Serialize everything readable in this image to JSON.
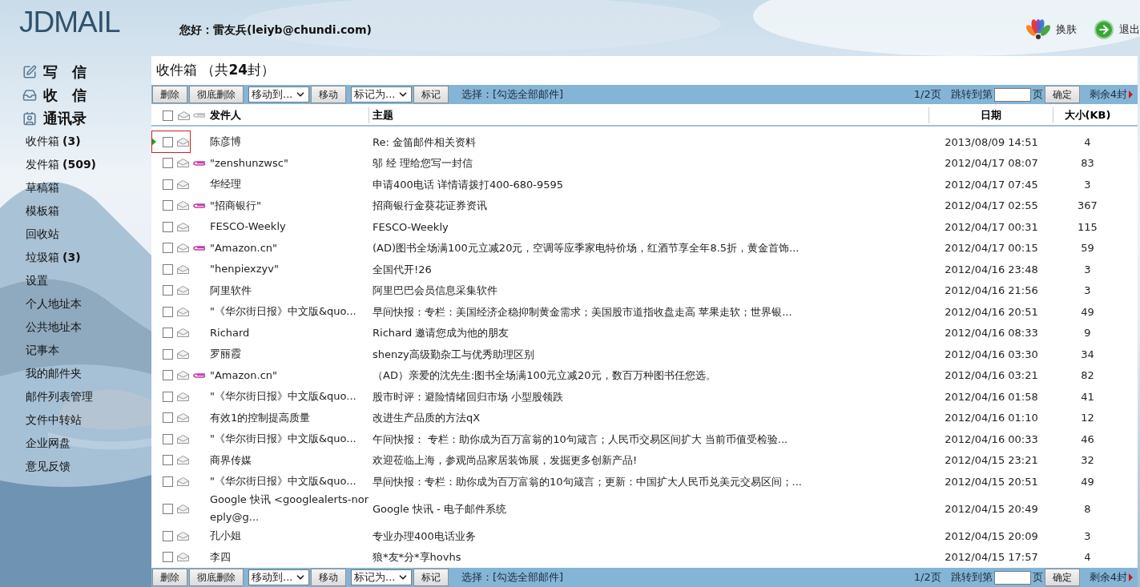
{
  "logo": "JDMAIL",
  "greeting": "您好：雷友兵(leiyb@chundi.com)",
  "header_links": [
    {
      "kind": "skin",
      "label": "换肤"
    },
    {
      "kind": "logout",
      "label": "退出"
    }
  ],
  "sidebar": {
    "actions": [
      {
        "kind": "compose",
        "label": "写　信"
      },
      {
        "kind": "receive",
        "label": "收　信"
      },
      {
        "kind": "contacts",
        "label": "通讯录"
      }
    ],
    "folders": [
      {
        "label": "收件箱",
        "count": "(3)"
      },
      {
        "label": "发件箱",
        "count": "(509)"
      },
      {
        "label": "草稿箱"
      },
      {
        "label": "模板箱"
      },
      {
        "label": "回收站"
      },
      {
        "label": "垃圾箱",
        "count": "(3)"
      },
      {
        "label": "设置"
      },
      {
        "label": "个人地址本"
      },
      {
        "label": "公共地址本"
      },
      {
        "label": "记事本"
      },
      {
        "label": "我的邮件夹"
      },
      {
        "label": "邮件列表管理"
      },
      {
        "label": "文件中转站"
      },
      {
        "label": "企业网盘"
      },
      {
        "label": "意见反馈"
      }
    ]
  },
  "title": "收件箱 （共**24**封）",
  "toolbars": [
    {
      "buttons": [
        "删除",
        "彻底删除"
      ],
      "move_select": "移动到...",
      "move_button": "移动",
      "mark_select": "标记为...",
      "mark_button": "标记",
      "select_all": "选择：[勾选全部邮件]",
      "page": "1/2页",
      "jump_label": "跳转到第",
      "page_suffix": "页",
      "go": "确定",
      "remaining": "剩余4封"
    },
    {
      "buttons": [
        "删除",
        "彻底删除"
      ],
      "move_select": "移动到...",
      "move_button": "移动",
      "mark_select": "标记为...",
      "mark_button": "标记",
      "select_all": "选择：[勾选全部邮件]",
      "page": "1/2页",
      "jump_label": "跳转到第",
      "page_suffix": "页",
      "go": "确定",
      "remaining": "剩余4封"
    }
  ],
  "table": {
    "header_checked": false,
    "columns": [
      "发件人",
      "主题",
      "日期",
      "大小(KB)"
    ],
    "rows": [
      {
        "sender": "陈彦博",
        "subject": "Re: 金笛邮件相关资料",
        "date": "2013/08/09 14:51",
        "size": "4",
        "attachment": false,
        "checked": false,
        "selected": true
      },
      {
        "sender": "\"zenshunzwsc\"",
        "subject": "邬 经 理给您写一封信",
        "date": "2012/04/17 08:07",
        "size": "83",
        "attachment": true,
        "checked": false,
        "selected": false
      },
      {
        "sender": "华经理",
        "subject": "申请400电话 详情请拨打400-680-9595",
        "date": "2012/04/17 07:45",
        "size": "3",
        "attachment": false,
        "checked": false,
        "selected": false
      },
      {
        "sender": "\"招商银行\"",
        "subject": "招商银行金葵花证券资讯",
        "date": "2012/04/17 02:55",
        "size": "367",
        "attachment": true,
        "checked": false,
        "selected": false
      },
      {
        "sender": "FESCO-Weekly",
        "subject": "FESCO-Weekly",
        "date": "2012/04/17 00:31",
        "size": "115",
        "attachment": false,
        "checked": false,
        "selected": false
      },
      {
        "sender": "\"Amazon.cn\"",
        "subject": "(AD)图书全场满100元立减20元，空调等应季家电特价场，红酒节享全年8.5折，黄金首饰...",
        "date": "2012/04/17 00:15",
        "size": "59",
        "attachment": true,
        "checked": false,
        "selected": false
      },
      {
        "sender": "\"henpiexzyv\"",
        "subject": "全国代开!26",
        "date": "2012/04/16 23:48",
        "size": "3",
        "attachment": false,
        "checked": false,
        "selected": false
      },
      {
        "sender": "阿里软件",
        "subject": "阿里巴巴会员信息采集软件",
        "date": "2012/04/16 21:56",
        "size": "3",
        "attachment": false,
        "checked": false,
        "selected": false
      },
      {
        "sender": "\"《华尔街日报》中文版&quo...",
        "subject": "早间快报：专栏：美国经济企稳抑制黄金需求；美国股市道指收盘走高 苹果走软；世界银...",
        "date": "2012/04/16 20:51",
        "size": "49",
        "attachment": false,
        "checked": false,
        "selected": false
      },
      {
        "sender": "Richard",
        "subject": "Richard 邀请您成为他的朋友",
        "date": "2012/04/16 08:33",
        "size": "9",
        "attachment": false,
        "checked": false,
        "selected": false
      },
      {
        "sender": "罗丽霞",
        "subject": "shenzy高级勤杂工与优秀助理区别",
        "date": "2012/04/16 03:30",
        "size": "34",
        "attachment": false,
        "checked": false,
        "selected": false
      },
      {
        "sender": "\"Amazon.cn\"",
        "subject": "（AD）亲爱的沈先生:图书全场满100元立减20元，数百万种图书任您选。",
        "date": "2012/04/16 03:21",
        "size": "82",
        "attachment": true,
        "checked": false,
        "selected": false
      },
      {
        "sender": "\"《华尔街日报》中文版&quo...",
        "subject": "股市时评：避险情绪回归市场 小型股领跌",
        "date": "2012/04/16 01:58",
        "size": "41",
        "attachment": false,
        "checked": false,
        "selected": false
      },
      {
        "sender": "有效1的控制提高质量",
        "subject": "改进生产品质的方法qX",
        "date": "2012/04/16 01:10",
        "size": "12",
        "attachment": false,
        "checked": false,
        "selected": false
      },
      {
        "sender": "\"《华尔街日报》中文版&quo...",
        "subject": "午间快报： 专栏：助你成为百万富翁的10句箴言；人民币交易区间扩大 当前币值受检验...",
        "date": "2012/04/16 00:33",
        "size": "46",
        "attachment": false,
        "checked": false,
        "selected": false
      },
      {
        "sender": "商界传媒",
        "subject": "欢迎莅临上海，参观尚品家居装饰展，发掘更多创新产品!",
        "date": "2012/04/15 23:21",
        "size": "32",
        "attachment": false,
        "checked": false,
        "selected": false
      },
      {
        "sender": "\"《华尔街日报》中文版&quo...",
        "subject": "早间快报：专栏：助你成为百万富翁的10句箴言；更新：中国扩大人民币兑美元交易区间；...",
        "date": "2012/04/15 20:51",
        "size": "49",
        "attachment": false,
        "checked": false,
        "selected": false
      },
      {
        "sender": "Google 快讯 <googlealerts-noreply@g...",
        "subject": "Google 快讯 - 电子邮件系统",
        "date": "2012/04/15 20:49",
        "size": "8",
        "attachment": false,
        "checked": false,
        "selected": false
      },
      {
        "sender": "孔小姐",
        "subject": "专业办理400电话业务",
        "date": "2012/04/15 20:09",
        "size": "3",
        "attachment": false,
        "checked": false,
        "selected": false
      },
      {
        "sender": "李四",
        "subject": "狼*友*分*享hovhs",
        "date": "2012/04/15 17:57",
        "size": "4",
        "attachment": false,
        "checked": false,
        "selected": false
      }
    ]
  }
}
